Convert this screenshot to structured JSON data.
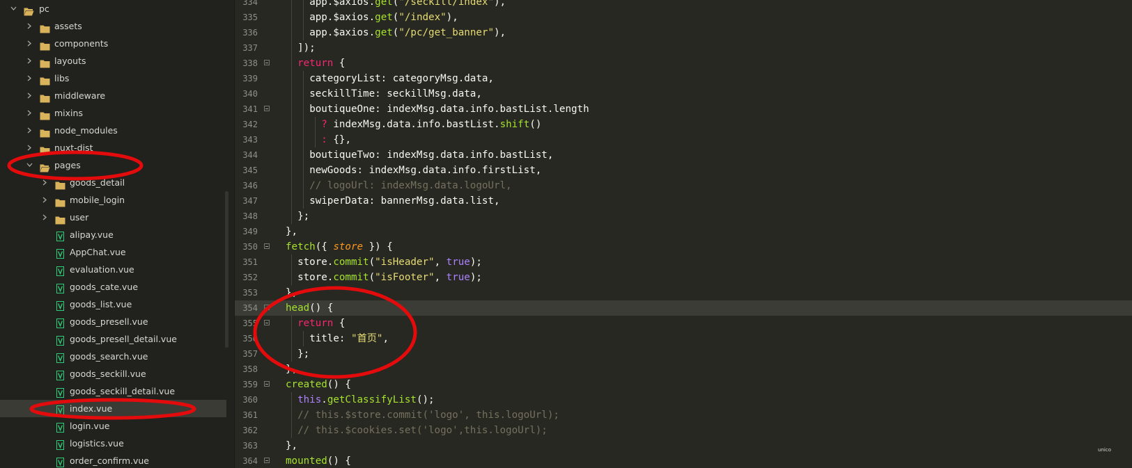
{
  "sidebar": {
    "rows": [
      {
        "name": "pc",
        "type": "folder",
        "open": true,
        "depth": 0,
        "arrow": true
      },
      {
        "name": "assets",
        "type": "folder",
        "open": false,
        "depth": 1,
        "arrow": true
      },
      {
        "name": "components",
        "type": "folder",
        "open": false,
        "depth": 1,
        "arrow": true
      },
      {
        "name": "layouts",
        "type": "folder",
        "open": false,
        "depth": 1,
        "arrow": true
      },
      {
        "name": "libs",
        "type": "folder",
        "open": false,
        "depth": 1,
        "arrow": true
      },
      {
        "name": "middleware",
        "type": "folder",
        "open": false,
        "depth": 1,
        "arrow": true
      },
      {
        "name": "mixins",
        "type": "folder",
        "open": false,
        "depth": 1,
        "arrow": true
      },
      {
        "name": "node_modules",
        "type": "folder",
        "open": false,
        "depth": 1,
        "arrow": true
      },
      {
        "name": "nuxt-dist",
        "type": "folder",
        "open": false,
        "depth": 1,
        "arrow": true
      },
      {
        "name": "pages",
        "type": "folder",
        "open": true,
        "depth": 1,
        "arrow": true
      },
      {
        "name": "goods_detail",
        "type": "folder",
        "open": false,
        "depth": 2,
        "arrow": true
      },
      {
        "name": "mobile_login",
        "type": "folder",
        "open": false,
        "depth": 2,
        "arrow": true
      },
      {
        "name": "user",
        "type": "folder",
        "open": false,
        "depth": 2,
        "arrow": true
      },
      {
        "name": "alipay.vue",
        "type": "vue",
        "depth": 2
      },
      {
        "name": "AppChat.vue",
        "type": "vue",
        "depth": 2
      },
      {
        "name": "evaluation.vue",
        "type": "vue",
        "depth": 2
      },
      {
        "name": "goods_cate.vue",
        "type": "vue",
        "depth": 2
      },
      {
        "name": "goods_list.vue",
        "type": "vue",
        "depth": 2
      },
      {
        "name": "goods_presell.vue",
        "type": "vue",
        "depth": 2
      },
      {
        "name": "goods_presell_detail.vue",
        "type": "vue",
        "depth": 2
      },
      {
        "name": "goods_search.vue",
        "type": "vue",
        "depth": 2
      },
      {
        "name": "goods_seckill.vue",
        "type": "vue",
        "depth": 2
      },
      {
        "name": "goods_seckill_detail.vue",
        "type": "vue",
        "depth": 2
      },
      {
        "name": "index.vue",
        "type": "vue",
        "depth": 2,
        "selected": true
      },
      {
        "name": "login.vue",
        "type": "vue",
        "depth": 2
      },
      {
        "name": "logistics.vue",
        "type": "vue",
        "depth": 2
      },
      {
        "name": "order_confirm.vue",
        "type": "vue",
        "depth": 2
      }
    ]
  },
  "editor": {
    "active_line": "354",
    "lines": [
      {
        "num": "334",
        "fold": false,
        "indent": 3,
        "tokens": [
          [
            "p",
            "app.$axios."
          ],
          [
            "f",
            "get"
          ],
          [
            "p",
            "("
          ],
          [
            "s",
            "\"/seckill/index\""
          ],
          [
            "p",
            "),"
          ]
        ]
      },
      {
        "num": "335",
        "fold": false,
        "indent": 3,
        "tokens": [
          [
            "p",
            "app.$axios."
          ],
          [
            "f",
            "get"
          ],
          [
            "p",
            "("
          ],
          [
            "s",
            "\"/index\""
          ],
          [
            "p",
            "),"
          ]
        ]
      },
      {
        "num": "336",
        "fold": false,
        "indent": 3,
        "tokens": [
          [
            "p",
            "app.$axios."
          ],
          [
            "f",
            "get"
          ],
          [
            "p",
            "("
          ],
          [
            "s",
            "\"/pc/get_banner\""
          ],
          [
            "p",
            "),"
          ]
        ]
      },
      {
        "num": "337",
        "fold": false,
        "indent": 2,
        "tokens": [
          [
            "p",
            "]);"
          ]
        ]
      },
      {
        "num": "338",
        "fold": true,
        "indent": 2,
        "tokens": [
          [
            "k",
            "return"
          ],
          [
            "p",
            " {"
          ]
        ]
      },
      {
        "num": "339",
        "fold": false,
        "indent": 3,
        "tokens": [
          [
            "p",
            "categoryList: categoryMsg.data,"
          ]
        ]
      },
      {
        "num": "340",
        "fold": false,
        "indent": 3,
        "tokens": [
          [
            "p",
            "seckillTime: seckillMsg.data,"
          ]
        ]
      },
      {
        "num": "341",
        "fold": true,
        "indent": 3,
        "tokens": [
          [
            "p",
            "boutiqueOne: indexMsg.data.info.bastList.length"
          ]
        ]
      },
      {
        "num": "342",
        "fold": false,
        "indent": 4,
        "tokens": [
          [
            "k",
            "?"
          ],
          [
            "p",
            " indexMsg.data.info.bastList."
          ],
          [
            "f",
            "shift"
          ],
          [
            "p",
            "()"
          ]
        ]
      },
      {
        "num": "343",
        "fold": false,
        "indent": 4,
        "tokens": [
          [
            "k",
            ":"
          ],
          [
            "p",
            " {},"
          ]
        ]
      },
      {
        "num": "344",
        "fold": false,
        "indent": 3,
        "tokens": [
          [
            "p",
            "boutiqueTwo: indexMsg.data.info.bastList,"
          ]
        ]
      },
      {
        "num": "345",
        "fold": false,
        "indent": 3,
        "tokens": [
          [
            "p",
            "newGoods: indexMsg.data.info.firstList,"
          ]
        ]
      },
      {
        "num": "346",
        "fold": false,
        "indent": 3,
        "tokens": [
          [
            "c",
            "// logoUrl: indexMsg.data.logoUrl,"
          ]
        ]
      },
      {
        "num": "347",
        "fold": false,
        "indent": 3,
        "tokens": [
          [
            "p",
            "swiperData: bannerMsg.data.list,"
          ]
        ]
      },
      {
        "num": "348",
        "fold": false,
        "indent": 2,
        "tokens": [
          [
            "p",
            "};"
          ]
        ]
      },
      {
        "num": "349",
        "fold": false,
        "indent": 1,
        "tokens": [
          [
            "p",
            "},"
          ]
        ]
      },
      {
        "num": "350",
        "fold": true,
        "indent": 1,
        "tokens": [
          [
            "f",
            "fetch"
          ],
          [
            "p",
            "({ "
          ],
          [
            "a",
            "store"
          ],
          [
            "p",
            " }) {"
          ]
        ]
      },
      {
        "num": "351",
        "fold": false,
        "indent": 2,
        "tokens": [
          [
            "p",
            "store."
          ],
          [
            "f",
            "commit"
          ],
          [
            "p",
            "("
          ],
          [
            "s",
            "\"isHeader\""
          ],
          [
            "p",
            ", "
          ],
          [
            "b",
            "true"
          ],
          [
            "p",
            ");"
          ]
        ]
      },
      {
        "num": "352",
        "fold": false,
        "indent": 2,
        "tokens": [
          [
            "p",
            "store."
          ],
          [
            "f",
            "commit"
          ],
          [
            "p",
            "("
          ],
          [
            "s",
            "\"isFooter\""
          ],
          [
            "p",
            ", "
          ],
          [
            "b",
            "true"
          ],
          [
            "p",
            ");"
          ]
        ]
      },
      {
        "num": "353",
        "fold": false,
        "indent": 1,
        "tokens": [
          [
            "p",
            "},"
          ]
        ]
      },
      {
        "num": "354",
        "fold": true,
        "indent": 1,
        "tokens": [
          [
            "f",
            "head"
          ],
          [
            "p",
            "() {"
          ]
        ]
      },
      {
        "num": "355",
        "fold": true,
        "indent": 2,
        "tokens": [
          [
            "k",
            "return"
          ],
          [
            "p",
            " {"
          ]
        ]
      },
      {
        "num": "356",
        "fold": false,
        "indent": 3,
        "tokens": [
          [
            "p",
            "title: "
          ],
          [
            "s",
            "\"首页\""
          ],
          [
            "p",
            ","
          ]
        ]
      },
      {
        "num": "357",
        "fold": false,
        "indent": 2,
        "tokens": [
          [
            "p",
            "};"
          ]
        ]
      },
      {
        "num": "358",
        "fold": false,
        "indent": 1,
        "tokens": [
          [
            "p",
            "},"
          ]
        ]
      },
      {
        "num": "359",
        "fold": true,
        "indent": 1,
        "tokens": [
          [
            "f",
            "created"
          ],
          [
            "p",
            "() {"
          ]
        ]
      },
      {
        "num": "360",
        "fold": false,
        "indent": 2,
        "tokens": [
          [
            "b",
            "this"
          ],
          [
            "p",
            "."
          ],
          [
            "f",
            "getClassifyList"
          ],
          [
            "p",
            "();"
          ]
        ]
      },
      {
        "num": "361",
        "fold": false,
        "indent": 2,
        "tokens": [
          [
            "c",
            "// this.$store.commit('logo', this.logoUrl);"
          ]
        ]
      },
      {
        "num": "362",
        "fold": false,
        "indent": 2,
        "tokens": [
          [
            "c",
            "// this.$cookies.set('logo',this.logoUrl);"
          ]
        ]
      },
      {
        "num": "363",
        "fold": false,
        "indent": 1,
        "tokens": [
          [
            "p",
            "},"
          ]
        ]
      },
      {
        "num": "364",
        "fold": true,
        "indent": 1,
        "tokens": [
          [
            "f",
            "mounted"
          ],
          [
            "p",
            "() {"
          ]
        ]
      }
    ]
  },
  "watermark": "unico",
  "colors": {
    "annotation": "#e30b0b",
    "folder": "#d9b35b",
    "vue_icon": "#2ecf7b"
  }
}
